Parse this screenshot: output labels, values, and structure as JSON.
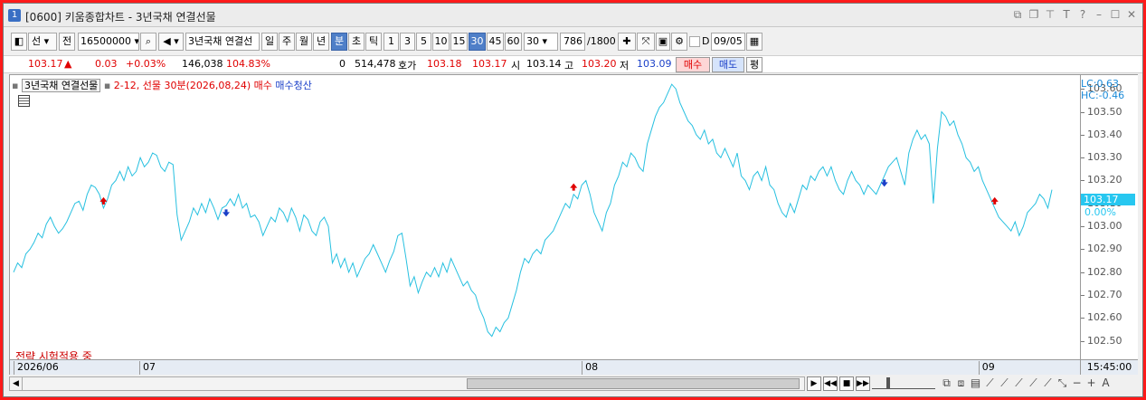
{
  "window": {
    "number": "1",
    "title": "[0600] 키움종합차트 - 3년국채 연결선물",
    "icons": [
      "restore-down-icon",
      "copy-window-icon",
      "pin-icon",
      "text-icon",
      "help-icon",
      "minimize-icon",
      "maximize-icon",
      "close-icon"
    ]
  },
  "toolbar": {
    "market": "선",
    "prev_next": "전",
    "code": "16500000",
    "product_name": "3년국채 연결선",
    "periods": [
      "일",
      "주",
      "월",
      "년",
      "분",
      "초",
      "틱"
    ],
    "active_period": "분",
    "intervals": [
      "1",
      "3",
      "5",
      "10",
      "15",
      "30",
      "45",
      "60"
    ],
    "active_interval": "30",
    "interval_select": "30",
    "count": "786",
    "count_total": "/1800",
    "checkbox_label": "D",
    "date": "09/05"
  },
  "quote": {
    "price": "103.17",
    "change": "0.03",
    "change_pct": "+0.03%",
    "volume": "146,038",
    "volume_ratio": "104.83%",
    "open_interest_change": "0",
    "open_interest": "514,478",
    "bid_label": "호가",
    "ask": "103.18",
    "bid": "103.17",
    "open_label": "시",
    "open": "103.14",
    "high_label": "고",
    "high": "103.20",
    "low_label": "저",
    "low": "103.09",
    "buy_label": "매수",
    "sell_label": "매도",
    "even_label": "평"
  },
  "chart": {
    "legend_name": "3년국채 연결선물",
    "legend_strategy": "2-12, 선물 30분(2026,08,24) 매수",
    "legend_exit": "매수청산",
    "lc_label": "LC:0.63",
    "hc_label": "HC:-0.46",
    "strategy_status": "전략 시험적용 중",
    "current_price": "103.17",
    "current_pct": "0.00%",
    "time_label": "15:45:00",
    "colors": {
      "line": "#27c0e0",
      "buy": "#e00000",
      "sell": "#1a3fc8"
    }
  },
  "chart_data": {
    "type": "line",
    "title": "",
    "xlabel": "",
    "ylabel": "",
    "ylim": [
      102.42,
      103.66
    ],
    "yticks": [
      "103.60",
      "103.50",
      "103.40",
      "103.30",
      "103.20",
      "103.10",
      "103.00",
      "102.90",
      "102.80",
      "102.70",
      "102.60",
      "102.50"
    ],
    "xticks": [
      {
        "label": "2026/06",
        "index": 0
      },
      {
        "label": "07",
        "index": 77
      },
      {
        "label": "08",
        "index": 348
      },
      {
        "label": "09",
        "index": 591
      }
    ],
    "series": [
      {
        "values": [
          102.8,
          102.84,
          102.82,
          102.88,
          102.9,
          102.93,
          102.97,
          102.95,
          103.01,
          103.04,
          103.0,
          102.97,
          102.99,
          103.02,
          103.06,
          103.1,
          103.11,
          103.07,
          103.14,
          103.18,
          103.17,
          103.14,
          103.08,
          103.12,
          103.18,
          103.2,
          103.24,
          103.2,
          103.26,
          103.22,
          103.24,
          103.3,
          103.26,
          103.28,
          103.32,
          103.31,
          103.26,
          103.24,
          103.28,
          103.27,
          103.05,
          102.94,
          102.98,
          103.02,
          103.08,
          103.05,
          103.1,
          103.06,
          103.12,
          103.08,
          103.03,
          103.08,
          103.09,
          103.12,
          103.09,
          103.14,
          103.08,
          103.1,
          103.04,
          103.05,
          103.02,
          102.96,
          103.0,
          103.04,
          103.02,
          103.08,
          103.06,
          103.02,
          103.08,
          103.04,
          102.98,
          103.05,
          103.03,
          102.98,
          102.96,
          103.02,
          103.04,
          103.0,
          102.84,
          102.88,
          102.82,
          102.86,
          102.8,
          102.84,
          102.78,
          102.82,
          102.86,
          102.88,
          102.92,
          102.88,
          102.84,
          102.8,
          102.85,
          102.89,
          102.96,
          102.97,
          102.86,
          102.74,
          102.78,
          102.71,
          102.76,
          102.8,
          102.78,
          102.82,
          102.78,
          102.84,
          102.8,
          102.86,
          102.82,
          102.78,
          102.74,
          102.76,
          102.72,
          102.7,
          102.64,
          102.6,
          102.54,
          102.52,
          102.56,
          102.54,
          102.58,
          102.6,
          102.66,
          102.72,
          102.8,
          102.86,
          102.84,
          102.88,
          102.9,
          102.88,
          102.94,
          102.96,
          102.98,
          103.02,
          103.06,
          103.1,
          103.08,
          103.14,
          103.12,
          103.18,
          103.2,
          103.14,
          103.06,
          103.02,
          102.98,
          103.06,
          103.1,
          103.18,
          103.22,
          103.28,
          103.26,
          103.32,
          103.3,
          103.26,
          103.24,
          103.36,
          103.42,
          103.48,
          103.52,
          103.54,
          103.58,
          103.62,
          103.6,
          103.54,
          103.5,
          103.46,
          103.44,
          103.4,
          103.38,
          103.42,
          103.36,
          103.38,
          103.32,
          103.3,
          103.34,
          103.3,
          103.26,
          103.32,
          103.22,
          103.2,
          103.16,
          103.22,
          103.24,
          103.2,
          103.26,
          103.18,
          103.16,
          103.1,
          103.06,
          103.04,
          103.1,
          103.06,
          103.12,
          103.18,
          103.16,
          103.22,
          103.2,
          103.24,
          103.26,
          103.22,
          103.26,
          103.2,
          103.16,
          103.14,
          103.2,
          103.24,
          103.2,
          103.18,
          103.14,
          103.18,
          103.16,
          103.14,
          103.18,
          103.22,
          103.26,
          103.28,
          103.3,
          103.24,
          103.18,
          103.32,
          103.38,
          103.42,
          103.38,
          103.4,
          103.36,
          103.1,
          103.34,
          103.5,
          103.48,
          103.44,
          103.46,
          103.4,
          103.36,
          103.3,
          103.28,
          103.24,
          103.26,
          103.2,
          103.16,
          103.12,
          103.08,
          103.04,
          103.02,
          103.0,
          102.98,
          103.02,
          102.96,
          103.0,
          103.06,
          103.08,
          103.1,
          103.14,
          103.12,
          103.08,
          103.16
        ]
      }
    ],
    "buy_signals": [
      22,
      137,
      240
    ],
    "sell_signals": [
      52,
      213,
      276
    ]
  }
}
